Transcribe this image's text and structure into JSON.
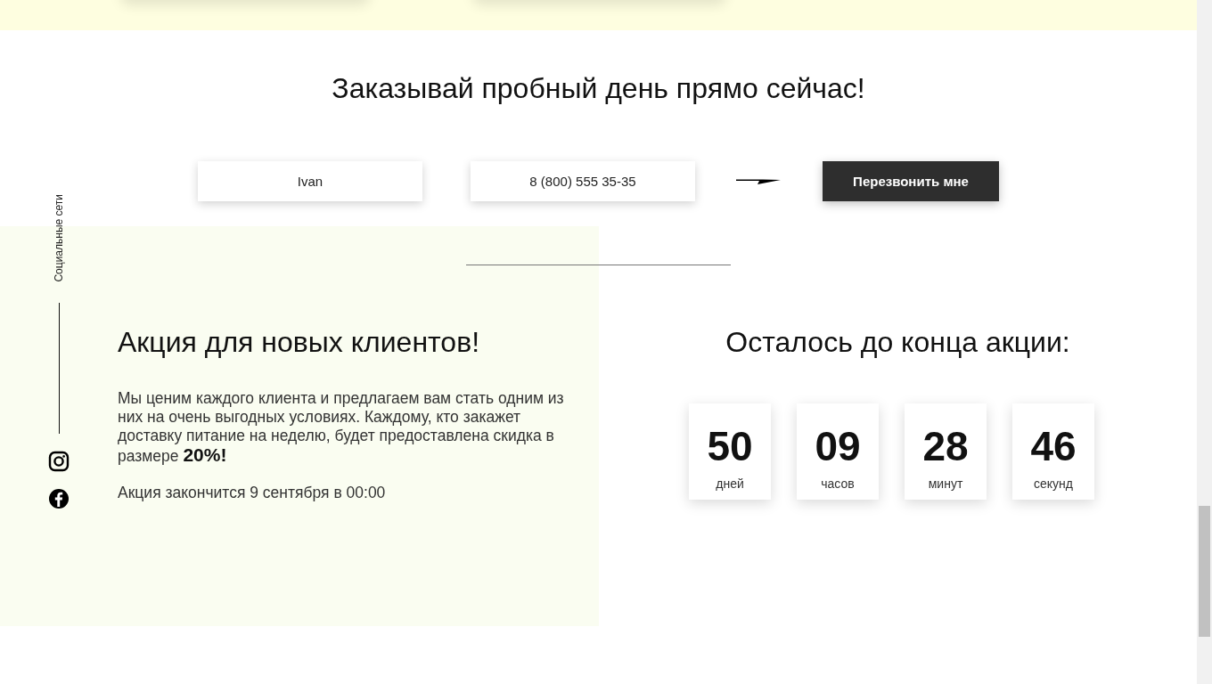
{
  "order": {
    "title": "Заказывай пробный день прямо сейчас!",
    "fields": [
      {
        "value": "Ivan"
      },
      {
        "value": "8 (800) 555 35-35"
      }
    ],
    "button": "Перезвонить мне"
  },
  "social": {
    "label": "Социальные сети"
  },
  "promo": {
    "title": "Акция для новых клиентов!",
    "text": "Мы ценим каждого клиента и предлагаем вам стать одним из них на очень выгодных условиях. Каждому, кто закажет доставку питание на неделю, будет предоставлена скидка в размере **20%!**",
    "deadline": "Акция закончится 9 сентября в 00:00"
  },
  "countdown": {
    "title": "Осталось до конца акции:",
    "units": [
      {
        "value": "50",
        "label": "дней"
      },
      {
        "value": "09",
        "label": "часов"
      },
      {
        "value": "28",
        "label": "минут"
      },
      {
        "value": "46",
        "label": "секунд"
      }
    ]
  }
}
